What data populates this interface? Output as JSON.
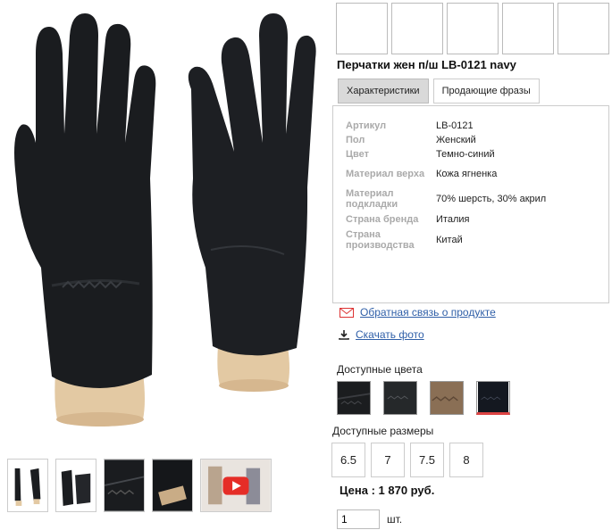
{
  "product": {
    "title": "Перчатки жен п/ш LB-0121 navy"
  },
  "tabs": [
    {
      "label": "Характеристики",
      "active": true
    },
    {
      "label": "Продающие фразы",
      "active": false
    }
  ],
  "specs": [
    {
      "key": "Артикул",
      "value": "LB-0121"
    },
    {
      "key": "Пол",
      "value": "Женский"
    },
    {
      "key": "Цвет",
      "value": "Темно-синий"
    },
    {
      "key": "Материал верха",
      "value": "Кожа ягненка"
    },
    {
      "key": "Материал подкладки",
      "value": "70% шерсть, 30% акрил"
    },
    {
      "key": "Страна бренда",
      "value": "Италия"
    },
    {
      "key": "Страна производства",
      "value": "Китай"
    }
  ],
  "links": {
    "feedback": {
      "label": "Обратная связь о продукте",
      "icon": "envelope-icon"
    },
    "download": {
      "label": "Скачать фото",
      "icon": "download-icon"
    }
  },
  "colors_section": {
    "label": "Доступные цвета",
    "swatches": [
      {
        "color": "#1b1d1f",
        "selected": false
      },
      {
        "color": "#25282a",
        "selected": false
      },
      {
        "color": "#8a6f55",
        "selected": false
      },
      {
        "color": "#141820",
        "selected": true
      }
    ]
  },
  "sizes_section": {
    "label": "Доступные размеры",
    "sizes": [
      "6.5",
      "7",
      "7.5",
      "8"
    ]
  },
  "price": {
    "text": "Цена : 1 870 руб."
  },
  "quantity": {
    "value": "1",
    "unit": "шт."
  },
  "accent_colors": {
    "link": "#2f5fa8",
    "video_play": "#e52d27",
    "selected_swatch": "#dd4444"
  }
}
